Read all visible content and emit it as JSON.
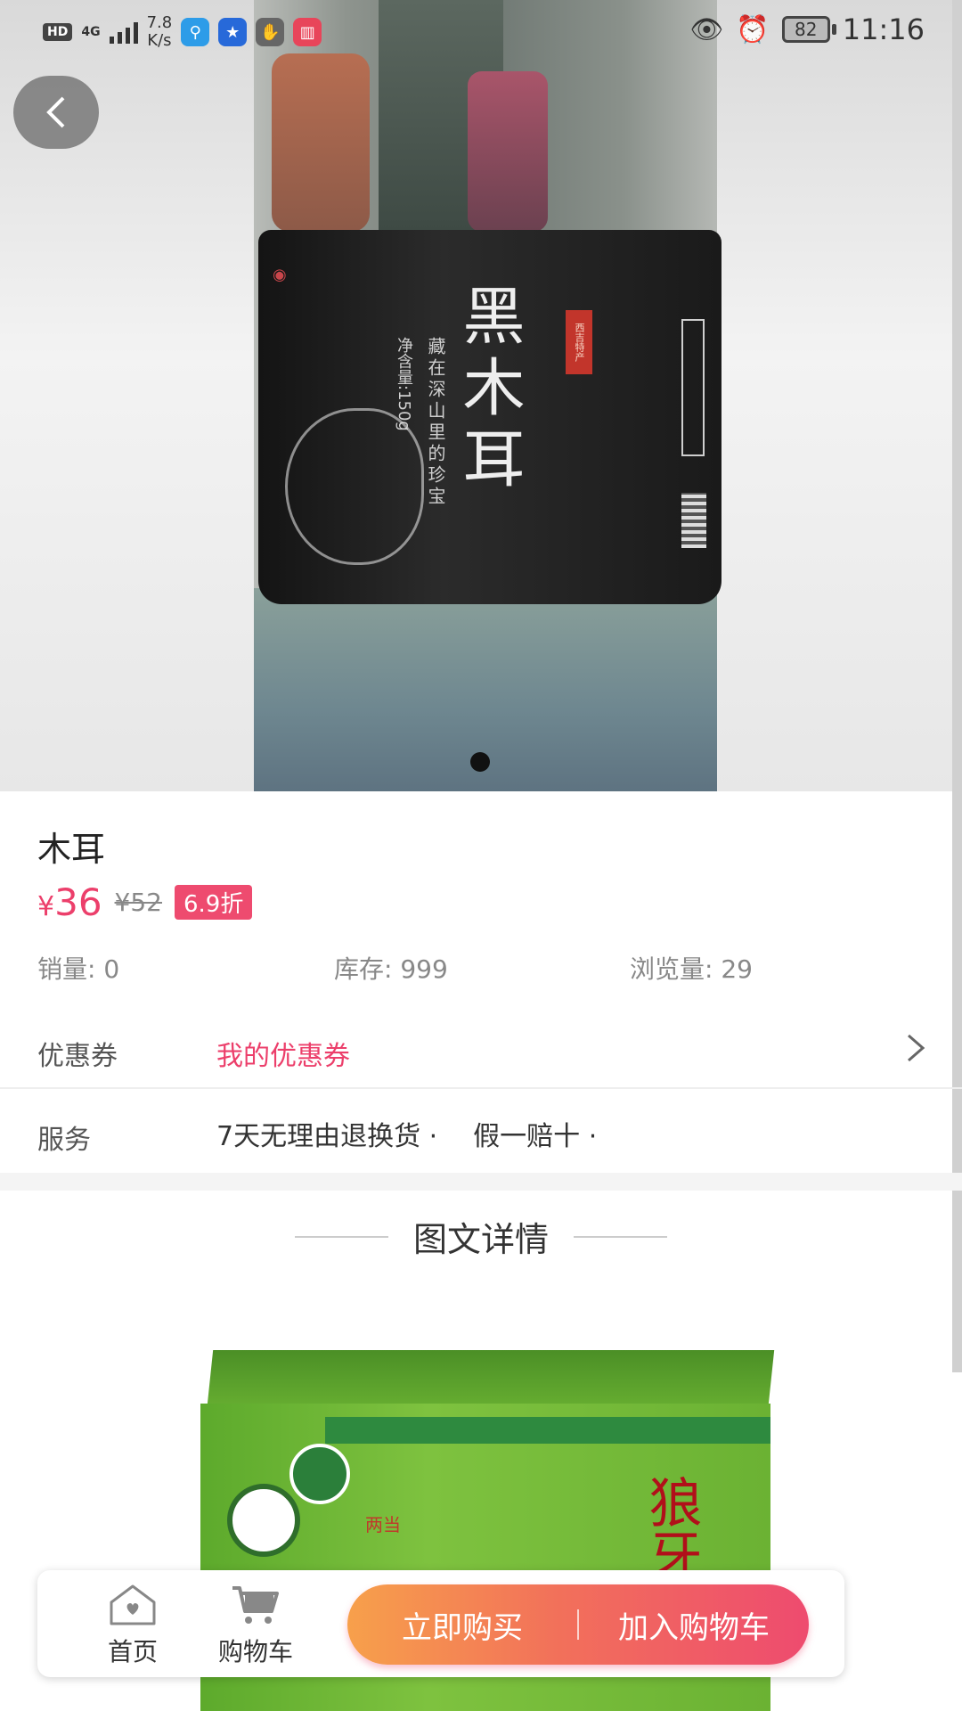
{
  "status_bar": {
    "hd": "HD",
    "network": "4G",
    "speed_value": "7.8",
    "speed_unit": "K/s",
    "battery": "82",
    "time": "11:16"
  },
  "hero": {
    "product_label": "黑木耳",
    "label_sub": "藏在深山里的珍宝",
    "label_weight": "净含量:150g",
    "seal": "西吉特产",
    "page_dots": 1,
    "active_dot": 0
  },
  "product": {
    "name": "木耳",
    "price_symbol": "¥",
    "price": "36",
    "original_price": "¥52",
    "discount": "6.9折",
    "sales": "销量: 0",
    "stock": "库存: 999",
    "views": "浏览量: 29"
  },
  "coupon": {
    "label": "优惠券",
    "link": "我的优惠券"
  },
  "service": {
    "label": "服务",
    "items": [
      "7天无理由退换货 ·",
      "假一赔十 ·"
    ]
  },
  "details": {
    "title": "图文详情",
    "box_name": "狼牙蜜",
    "box_prefix": "两当"
  },
  "action_bar": {
    "home": "首页",
    "cart": "购物车",
    "buy_now": "立即购买",
    "add_to_cart": "加入购物车"
  },
  "colors": {
    "accent": "#ec3f6b",
    "gradient_start": "#f7a04b",
    "gradient_end": "#ee4b6f"
  }
}
